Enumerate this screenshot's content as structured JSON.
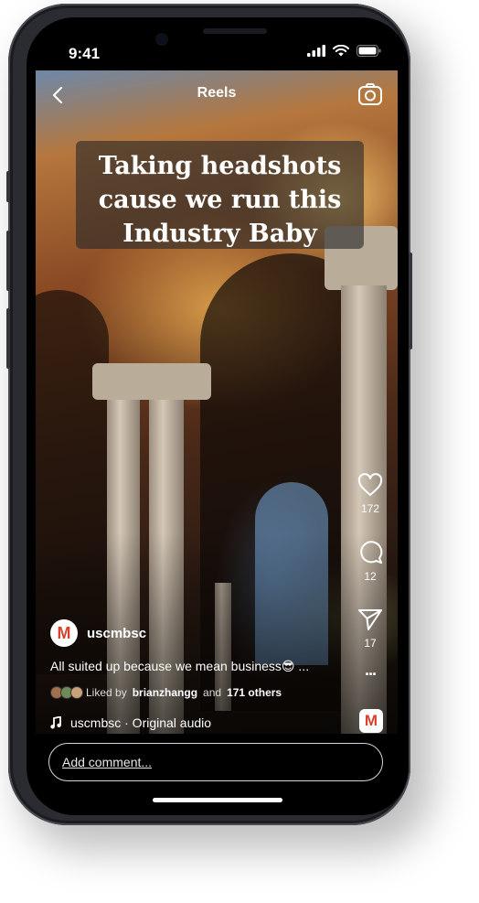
{
  "status_bar": {
    "time": "9:41"
  },
  "header": {
    "title": "Reels"
  },
  "video": {
    "caption_lines": [
      "Taking headshots",
      "cause we run this",
      "Industry Baby"
    ]
  },
  "actions": {
    "likes": "172",
    "comments": "12",
    "shares": "17",
    "more": "···"
  },
  "post": {
    "avatar_letter": "M",
    "username": "uscmbsc",
    "description": "All suited up because we mean business😎 ...",
    "liked_prefix": "Liked by",
    "liked_user": "brianzhangg",
    "liked_suffix": "and",
    "liked_others": "171 others",
    "audio": "uscmbsc · Original audio",
    "audio_thumb_letter": "M"
  },
  "comment": {
    "placeholder": "Add comment..."
  },
  "colors": {
    "brand_red": "#d9412f",
    "background": "#000000"
  }
}
